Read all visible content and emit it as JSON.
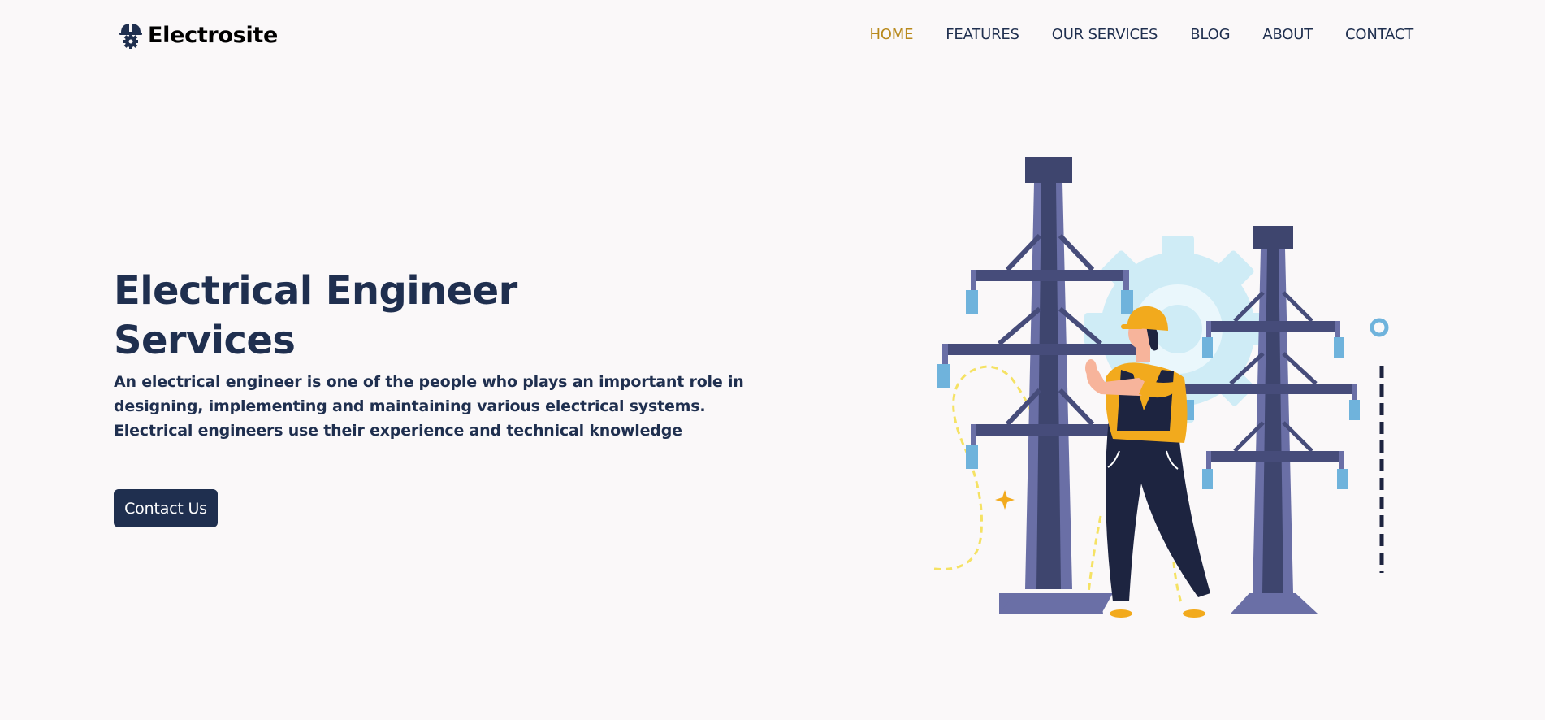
{
  "brand": {
    "name": "Electrosite",
    "icon": "helmet-gear-icon"
  },
  "nav": {
    "items": [
      "HOME",
      "FEATURES",
      "OUR SERVICES",
      "BLOG",
      "ABOUT",
      "CONTACT"
    ],
    "active": "HOME"
  },
  "hero": {
    "title_line1": "Electrical Engineer",
    "title_line2": "Services",
    "description": "An electrical engineer is one of the people who plays an important role in designing, implementing and maintaining various electrical systems. Electrical engineers use their experience and technical knowledge",
    "cta_label": "Contact Us"
  },
  "illustration": {
    "subject": "engineer-with-power-towers-illustration"
  },
  "colors": {
    "background": "#faf8f9",
    "primary": "#1f2f4f",
    "accent": "#b8891b",
    "tower": "#3e456e",
    "tower_light": "#6a6fa6",
    "insulator": "#6fb3dc",
    "gear": "#cfecf6",
    "helmet": "#f2aa1d",
    "overalls": "#1d2440",
    "wire": "#f5e264"
  }
}
